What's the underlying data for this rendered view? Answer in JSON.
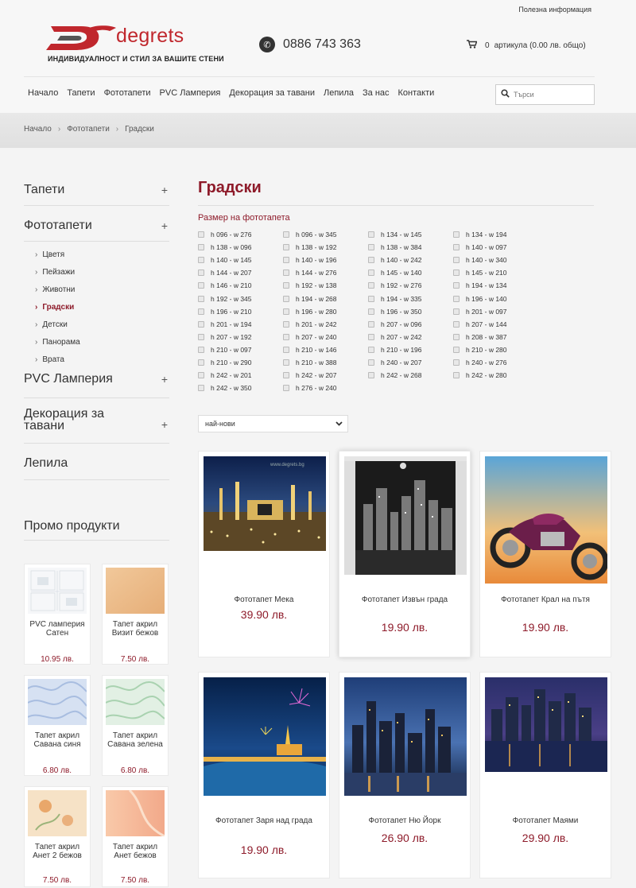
{
  "header": {
    "useful_info": "Полезна информация",
    "logo_word": "degrets",
    "logo_tagline": "ИНДИВИДУАЛНОСТ И СТИЛ ЗА ВАШИТЕ СТЕНИ",
    "phone": "0886 743 363",
    "cart_count": "0",
    "cart_text": "артикула (0.00 лв. общо)"
  },
  "nav": {
    "items": [
      "Начало",
      "Тапети",
      "Фототапети",
      "PVC Ламперия",
      "Декорация за тавани",
      "Лепила",
      "За нас",
      "Контакти"
    ],
    "search_placeholder": "Търси"
  },
  "breadcrumb": [
    "Начало",
    "Фототапети",
    "Градски"
  ],
  "sidebar": {
    "categories": [
      {
        "label": "Тапети"
      },
      {
        "label": "Фототапети",
        "subcategories": [
          "Цветя",
          "Пейзажи",
          "Животни",
          "Градски",
          "Детски",
          "Панорама",
          "Врата"
        ],
        "active": "Градски"
      },
      {
        "label": "PVC Ламперия"
      },
      {
        "label": "Декорация за тавани"
      },
      {
        "label": "Лепила"
      }
    ],
    "plus": "+",
    "promo_title": "Промо продукти",
    "promos": [
      {
        "name": "PVC ламперия Сатен",
        "price": "10.95 лв."
      },
      {
        "name": "Тапет акрил Визит бежов",
        "price": "7.50 лв."
      },
      {
        "name": "Тапет акрил Савана синя",
        "price": "6.80 лв."
      },
      {
        "name": "Тапет акрил Савана зелена",
        "price": "6.80 лв."
      },
      {
        "name": "Тапет акрил Анет 2 бежов",
        "price": "7.50 лв."
      },
      {
        "name": "Тапет акрил Анет бежов",
        "price": "7.50 лв."
      }
    ]
  },
  "main": {
    "title": "Градски",
    "size_heading": "Размер на фототапета",
    "sizes": [
      [
        "h 096 - w 276",
        "h 096 - w 345",
        "h 134 - w 145",
        "h 134 - w 194"
      ],
      [
        "h 138 - w 096",
        "h 138 - w 192",
        "h 138 - w 384",
        "h 140 - w 097"
      ],
      [
        "h 140 - w 145",
        "h 140 - w 196",
        "h 140 - w 242",
        "h 140 - w 340"
      ],
      [
        "h 144 - w 207",
        "h 144 - w 276",
        "h 145 - w 140",
        "h 145 - w 210"
      ],
      [
        "h 146 - w 210",
        "h 192 - w 138",
        "h 192 - w 276",
        "h 194 - w 134"
      ],
      [
        "h 192 - w 345",
        "h 194 - w 268",
        "h 194 - w 335",
        "h 196 - w 140"
      ],
      [
        "h 196 - w 210",
        "h 196 - w 280",
        "h 196 - w 350",
        "h 201 - w 097"
      ],
      [
        "h 201 - w 194",
        "h 201 - w 242",
        "h 207 - w 096",
        "h 207 - w 144"
      ],
      [
        "h 207 - w 192",
        "h 207 - w 240",
        "h 207 - w 242",
        "h 208 - w 387"
      ],
      [
        "h 210 - w 097",
        "h 210 - w 146",
        "h 210 - w 196",
        "h 210 - w 280"
      ],
      [
        "h 210 - w 290",
        "h 210 - w 388",
        "h 240 - w 207",
        "h 240 - w 276"
      ],
      [
        "h 242 - w 201",
        "h 242 - w 207",
        "h 242 - w 268",
        "h 242 - w 280"
      ],
      [
        "h 242 - w 350",
        "h 276 - w 240"
      ]
    ],
    "sort_selected": "най-нови",
    "products": [
      {
        "name": "Фототапет Мека",
        "price": "39.90 лв."
      },
      {
        "name": "Фототапет Извън града",
        "price": "19.90 лв."
      },
      {
        "name": "Фототапет Крал на пътя",
        "price": "19.90 лв."
      },
      {
        "name": "Фототапет Заря над града",
        "price": "19.90 лв."
      },
      {
        "name": "Фототапет Ню Йорк",
        "price": "26.90 лв."
      },
      {
        "name": "Фототапет Маями",
        "price": "29.90 лв."
      }
    ]
  },
  "colors": {
    "accent": "#8e1b2a",
    "logo_red": "#c0272d"
  }
}
